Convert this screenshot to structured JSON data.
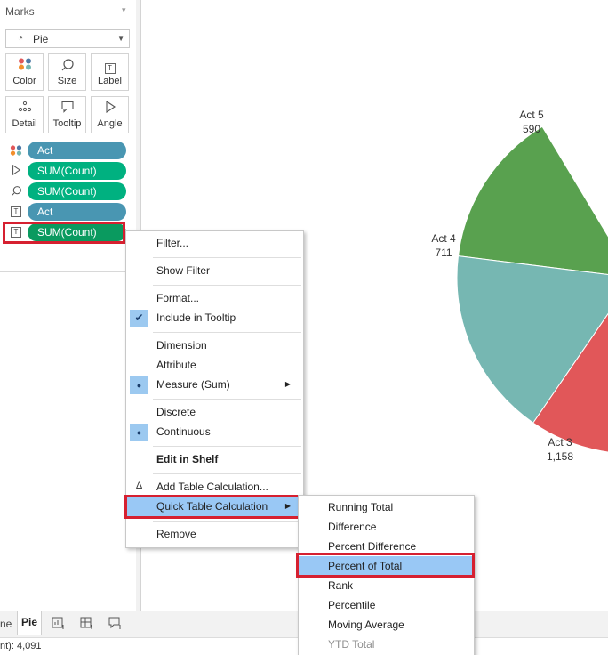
{
  "marks_panel": {
    "title": "Marks",
    "collapse_glyph": "▾",
    "mark_type": {
      "value": "Pie",
      "icon": "pie-icon"
    },
    "buttons": [
      {
        "label": "Color",
        "icon": "color-icon"
      },
      {
        "label": "Size",
        "icon": "size-icon"
      },
      {
        "label": "Label",
        "icon": "label-icon"
      },
      {
        "label": "Detail",
        "icon": "detail-icon"
      },
      {
        "label": "Tooltip",
        "icon": "tooltip-icon"
      },
      {
        "label": "Angle",
        "icon": "angle-icon"
      }
    ],
    "pills": [
      {
        "label": "Act",
        "icon": "color-icon",
        "color": "#4996b2"
      },
      {
        "label": "SUM(Count)",
        "icon": "angle-icon",
        "color": "#00b180"
      },
      {
        "label": "SUM(Count)",
        "icon": "size-icon",
        "color": "#00b180"
      },
      {
        "label": "Act",
        "icon": "label-icon",
        "color": "#4996b2"
      },
      {
        "label": "SUM(Count)",
        "icon": "label-icon",
        "color": "#0a9a5f"
      }
    ]
  },
  "chart_data": {
    "type": "pie",
    "slices": [
      {
        "label": "Act 5",
        "value": 590,
        "value_label": "590",
        "color": "#59a14f"
      },
      {
        "label": "Act 4",
        "value": 711,
        "value_label": "711",
        "color": "#76b7b2"
      },
      {
        "label": "Act 3",
        "value": 1158,
        "value_label": "1,158",
        "color": "#e15759"
      }
    ]
  },
  "context_menu": {
    "items": {
      "filter": "Filter...",
      "show_filter": "Show Filter",
      "format": "Format...",
      "include_tooltip": "Include in Tooltip",
      "dimension": "Dimension",
      "attribute": "Attribute",
      "measure": "Measure (Sum)",
      "discrete": "Discrete",
      "continuous": "Continuous",
      "edit_in_shelf": "Edit in Shelf",
      "add_table_calc": "Add Table Calculation...",
      "quick_table_calc": "Quick Table Calculation",
      "remove": "Remove"
    },
    "check_glyph": "✔",
    "bullet_glyph": "●",
    "delta_glyph": "Δ",
    "submenu_arrow": "▶"
  },
  "quick_table_calc_submenu": {
    "items": [
      "Running Total",
      "Difference",
      "Percent Difference",
      "Percent of Total",
      "Rank",
      "Percentile",
      "Moving Average",
      "YTD Total"
    ],
    "selected": "Percent of Total",
    "disabled": "YTD Total"
  },
  "tabs": {
    "previous_tab_fragment": "ne",
    "active": "Pie"
  },
  "status": {
    "text": "nt): 4,091"
  }
}
